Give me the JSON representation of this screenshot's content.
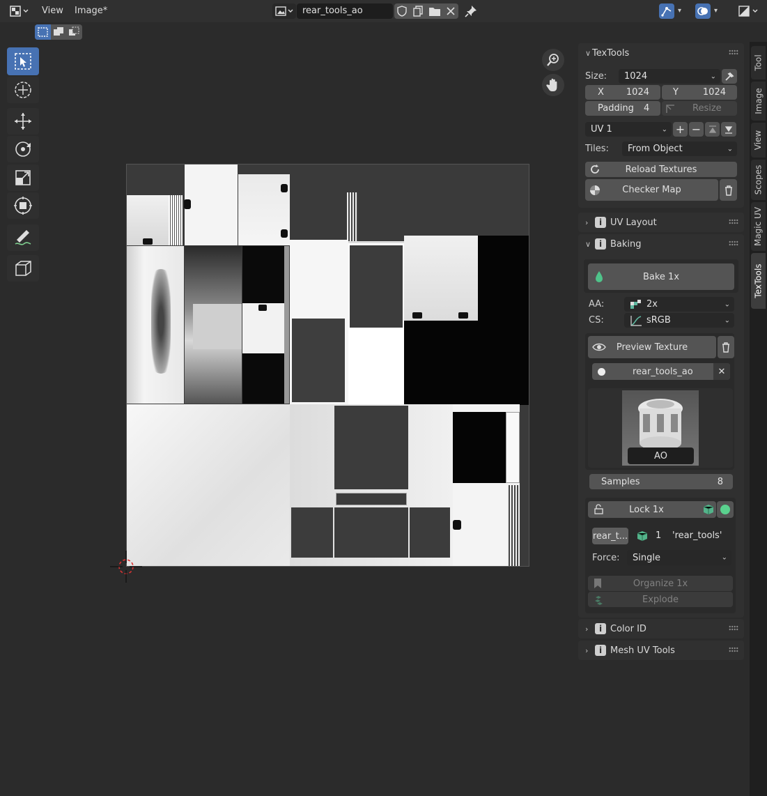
{
  "header": {
    "editor_type_icon": "image-editor-icon",
    "menus": [
      "View",
      "Image*"
    ],
    "image_name": "rear_tools_ao",
    "icons": [
      "shield-icon",
      "duplicate-icon",
      "folder-icon",
      "close-icon",
      "pin-icon",
      "uv-sync-icon",
      "overlay-icon",
      "display-channels-icon"
    ]
  },
  "subheader": {
    "select_modes": [
      "select-mode-set-icon",
      "select-mode-extend-icon",
      "select-mode-subtract-icon"
    ]
  },
  "toolbar": {
    "tools": [
      "select-box-icon",
      "cursor-icon",
      "move-icon",
      "rotate-icon",
      "scale-icon",
      "transform-icon",
      "annotate-icon",
      "sample-icon"
    ]
  },
  "viewport": {
    "nav_icons": [
      "zoom-icon",
      "pan-hand-icon"
    ]
  },
  "texTools": {
    "panel_title": "TexTools",
    "size_label": "Size:",
    "size_value": "1024",
    "x_label": "X",
    "x_value": "1024",
    "y_label": "Y",
    "y_value": "1024",
    "padding_label": "Padding",
    "padding_value": "4",
    "resize_label": "Resize",
    "uv_channel": "UV 1",
    "tiles_label": "Tiles:",
    "tiles_value": "From Object",
    "reload_label": "Reload Textures",
    "checker_label": "Checker Map"
  },
  "uvLayout": {
    "title": "UV Layout"
  },
  "baking": {
    "title": "Baking",
    "bake_label": "Bake 1x",
    "aa_label": "AA:",
    "aa_value": "2x",
    "cs_label": "CS:",
    "cs_value": "sRGB",
    "preview_label": "Preview Texture",
    "texture_name": "rear_tools_ao",
    "thumbnail_label": "AO",
    "samples_label": "Samples",
    "samples_value": "8",
    "lock_label": "Lock 1x",
    "object_short": "rear_t...",
    "object_count": "1",
    "object_name": "'rear_tools'",
    "force_label": "Force:",
    "force_value": "Single",
    "organize_label": "Organize 1x",
    "explode_label": "Explode"
  },
  "colorId": {
    "title": "Color ID"
  },
  "meshUvTools": {
    "title": "Mesh UV Tools"
  },
  "tabs": [
    "Tool",
    "Image",
    "View",
    "Scopes",
    "Magic UV",
    "TexTools"
  ],
  "colors": {
    "accent": "#4772b3",
    "panel": "#303030",
    "background": "#2b2b2b"
  }
}
